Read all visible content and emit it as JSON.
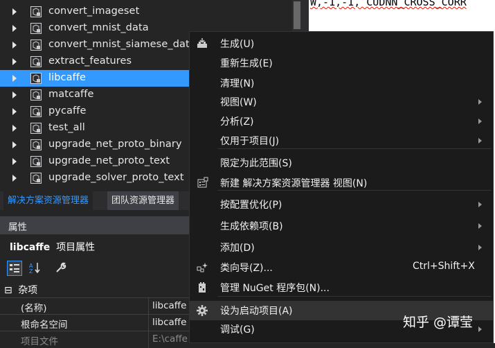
{
  "editor": {
    "code_text": "W,-1,-1, CUDNN_CROSS_CORR"
  },
  "solution_explorer": {
    "items": [
      {
        "label": "convert_imageset",
        "selected": false
      },
      {
        "label": "convert_mnist_data",
        "selected": false
      },
      {
        "label": "convert_mnist_siamese_data",
        "selected": false
      },
      {
        "label": "extract_features",
        "selected": false
      },
      {
        "label": "libcaffe",
        "selected": true
      },
      {
        "label": "matcaffe",
        "selected": false
      },
      {
        "label": "pycaffe",
        "selected": false
      },
      {
        "label": "test_all",
        "selected": false
      },
      {
        "label": "upgrade_net_proto_binary",
        "selected": false
      },
      {
        "label": "upgrade_net_proto_text",
        "selected": false
      },
      {
        "label": "upgrade_solver_proto_text",
        "selected": false
      }
    ]
  },
  "tabs": {
    "active": "解决方案资源管理器",
    "inactive": "团队资源管理器"
  },
  "properties": {
    "title": "属性",
    "subject_name": "libcaffe",
    "subject_type": "项目属性",
    "category": "杂项",
    "category_toggle": "⊟",
    "rows": [
      {
        "name": "(名称)",
        "value": "libcaffe"
      },
      {
        "name": "根命名空间",
        "value": "libcaffe"
      },
      {
        "name": "项目文件",
        "value": "E:\\caffe"
      }
    ]
  },
  "context_menu": {
    "items": [
      {
        "label": "生成(U)",
        "icon": "build-icon",
        "submenu": false,
        "shortcut": ""
      },
      {
        "label": "重新生成(E)",
        "icon": "",
        "submenu": false,
        "shortcut": ""
      },
      {
        "label": "清理(N)",
        "icon": "",
        "submenu": false,
        "shortcut": ""
      },
      {
        "label": "视图(W)",
        "icon": "",
        "submenu": true,
        "shortcut": ""
      },
      {
        "label": "分析(Z)",
        "icon": "",
        "submenu": true,
        "shortcut": ""
      },
      {
        "label": "仅用于项目(J)",
        "icon": "",
        "submenu": true,
        "shortcut": ""
      },
      {
        "label": "限定为此范围(S)",
        "icon": "",
        "submenu": false,
        "shortcut": ""
      },
      {
        "label": "新建 解决方案资源管理器 视图(N)",
        "icon": "new-view-icon",
        "submenu": false,
        "shortcut": ""
      },
      {
        "label": "按配置优化(P)",
        "icon": "",
        "submenu": true,
        "shortcut": ""
      },
      {
        "label": "生成依赖项(B)",
        "icon": "",
        "submenu": true,
        "shortcut": ""
      },
      {
        "label": "添加(D)",
        "icon": "",
        "submenu": true,
        "shortcut": ""
      },
      {
        "label": "类向导(Z)...",
        "icon": "class-wizard-icon",
        "submenu": false,
        "shortcut": "Ctrl+Shift+X"
      },
      {
        "label": "管理 NuGet 程序包(N)...",
        "icon": "nuget-icon",
        "submenu": false,
        "shortcut": ""
      },
      {
        "label": "设为启动项目(A)",
        "icon": "gear-icon",
        "submenu": false,
        "shortcut": "",
        "highlighted": true
      },
      {
        "label": "调试(G)",
        "icon": "",
        "submenu": true,
        "shortcut": ""
      }
    ]
  },
  "watermark": "知乎 @谭莹",
  "colors": {
    "selection": "#3399ff",
    "background": "#252526",
    "menu_background": "#1b1b1c"
  }
}
